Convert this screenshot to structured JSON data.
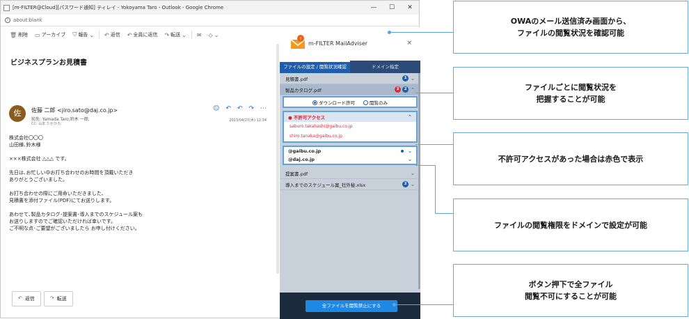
{
  "window": {
    "title": "[m-FILTER@Cloud][パスワード通知] ティレイ - Yokoyama Taro - Outlook - Google Chrome",
    "controls": [
      "—",
      "☐",
      "✕"
    ],
    "address": "about:blank"
  },
  "toolbar": {
    "delete": "削除",
    "archive": "アーカイブ",
    "report": "報告",
    "reply": "返信",
    "reply_all": "全員に返信",
    "forward": "転送"
  },
  "mail": {
    "subject": "ビジネスプランお見積書",
    "avatar_char": "佐",
    "sender": "佐藤 二郎 <jiro.sato@daj.co.jp>",
    "to": "宛先: Yamada.Taro;鈴木 一郎;",
    "cc": "CC: 山本 たかひろ;",
    "date": "2023/04/27(木) 12:34",
    "body": [
      "株式会社〇〇〇\n山田様､鈴木様",
      "×××株式会社 △△△ です。",
      "先日は､お忙しい中お打ち合わせのお時間を頂戴いただき\nありがとうございました。",
      "お打ち合わせの際にご用命いただきました､\n見積書を添付ファイル(PDF)にてお送りします。",
      "あわせて､製品カタログ･提案書･導入までのスケジュール案も\nお送りしますのでご確認いただければ幸いです。\nご不明な点･ご要望がございましたら お申し付けください。"
    ],
    "reply_label": "返信",
    "forward_label": "転送"
  },
  "panel": {
    "title": "m-FILTER MailAdviser",
    "close": "×",
    "tabs": [
      "ファイルの設定 / 閲覧状況確認",
      "ドメイン指定"
    ],
    "files": [
      {
        "name": "見積書.pdf",
        "badges": [
          {
            "color": "blue",
            "count": "1"
          }
        ]
      },
      {
        "name": "製品カタログ.pdf",
        "badges": [
          {
            "color": "red",
            "count": "2"
          },
          {
            "color": "blue",
            "count": "2"
          }
        ]
      },
      {
        "name": "提案書.pdf",
        "badges": []
      },
      {
        "name": "導入までのスケジュール案_社外秘.xlsx",
        "badges": [
          {
            "color": "blue",
            "count": "2"
          }
        ]
      }
    ],
    "perm_download": "ダウンロード許可",
    "perm_view": "閲覧のみ",
    "deny_head": "● 不許可アクセス",
    "deny_items": [
      "saburo.takahashi@gaibu.co.jp",
      "shiro.tanaka@gaibu.co.jp"
    ],
    "domains": [
      "@gaibu.co.jp",
      "@daj.co.jp"
    ],
    "button_all": "全ファイルを閲覧禁止にする"
  },
  "callouts": [
    "OWAのメール送信済み画面から、\nファイルの閲覧状況を確認可能",
    "ファイルごとに閲覧状況を\n把握することが可能",
    "不許可アクセスがあった場合は赤色で表示",
    "ファイルの閲覧権限をドメインで設定が可能",
    "ボタン押下で全ファイル\n閲覧不可にすることが可能"
  ],
  "colors": {
    "accent": "#1f5eab",
    "callout_border": "#6aa8de",
    "deny_red": "#e02a3c",
    "footer": "#1b2a3d"
  }
}
